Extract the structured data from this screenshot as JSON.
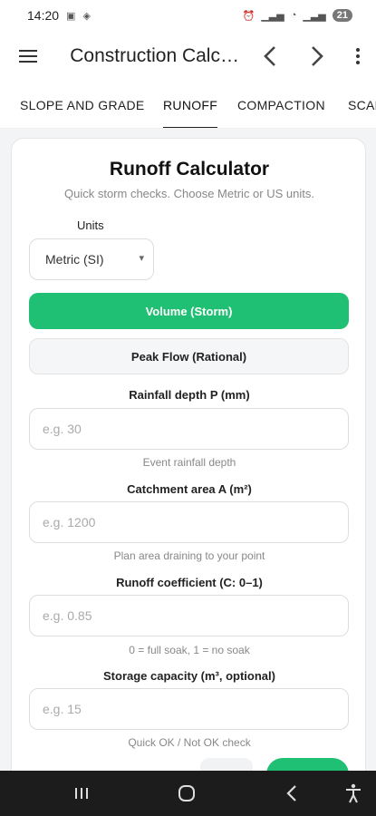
{
  "status": {
    "time": "14:20",
    "battery": "21"
  },
  "appbar": {
    "title": "Construction Calculators"
  },
  "tabs": [
    {
      "label": "SLOPE AND GRADE"
    },
    {
      "label": "RUNOFF"
    },
    {
      "label": "COMPACTION"
    },
    {
      "label": "SCALE"
    }
  ],
  "card": {
    "title": "Runoff Calculator",
    "subtitle": "Quick storm checks. Choose Metric or US units.",
    "units_label": "Units",
    "units_value": "Metric (SI)",
    "mode_volume": "Volume (Storm)",
    "mode_peak": "Peak Flow (Rational)",
    "fields": [
      {
        "label": "Rainfall depth P (mm)",
        "placeholder": "e.g. 30",
        "help": "Event rainfall depth"
      },
      {
        "label": "Catchment area A (m²)",
        "placeholder": "e.g. 1200",
        "help": "Plan area draining to your point"
      },
      {
        "label": "Runoff coefficient (C: 0–1)",
        "placeholder": "e.g. 0.85",
        "help": "0 = full soak, 1 = no soak"
      },
      {
        "label": "Storage capacity (m³, optional)",
        "placeholder": "e.g. 15",
        "help": "Quick OK / Not OK check"
      }
    ]
  },
  "colors": {
    "accent": "#20c074"
  }
}
